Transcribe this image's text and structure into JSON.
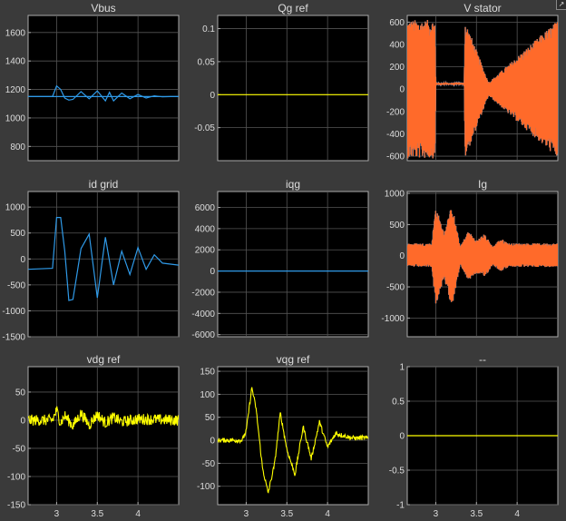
{
  "colors": {
    "figure_bg": "#3a3a3a",
    "axes_bg": "#000000",
    "axes_edge": "#aaaaaa",
    "grid": "#555555",
    "text": "#dddddd",
    "blue": "#2f9ae8",
    "orange": "#ff6a2a",
    "yellow": "#ffff00"
  },
  "icons": {
    "undock": "undock-arrow-icon"
  },
  "chart_data": [
    {
      "id": "vbus",
      "type": "line",
      "title": "Vbus",
      "xlim": [
        2.65,
        4.5
      ],
      "ylim": [
        700,
        1720
      ],
      "yticks": [
        "800",
        "1000",
        "1200",
        "1400",
        "1600"
      ],
      "xticks": [],
      "grid": true,
      "series": [
        {
          "color": "blue",
          "style": "line",
          "x": [
            2.65,
            2.95,
            3.0,
            3.05,
            3.1,
            3.15,
            3.2,
            3.3,
            3.4,
            3.5,
            3.6,
            3.65,
            3.7,
            3.8,
            3.9,
            4.0,
            4.1,
            4.2,
            4.3,
            4.4,
            4.5
          ],
          "y": [
            1150,
            1150,
            1225,
            1200,
            1140,
            1125,
            1130,
            1185,
            1135,
            1190,
            1120,
            1180,
            1120,
            1175,
            1135,
            1165,
            1140,
            1155,
            1148,
            1150,
            1150
          ]
        },
        {
          "color": "blue",
          "style": "flat",
          "x": [
            2.65,
            4.5
          ],
          "y": [
            1150,
            1150
          ]
        }
      ]
    },
    {
      "id": "qg_ref",
      "type": "line",
      "title": "Qg ref",
      "xlim": [
        2.65,
        4.5
      ],
      "ylim": [
        -0.1,
        0.12
      ],
      "yticks": [
        "-0.05",
        "0",
        "0.05",
        "0.1"
      ],
      "xticks": [],
      "grid": true,
      "series": [
        {
          "color": "yellow",
          "style": "flat",
          "x": [
            2.65,
            4.5
          ],
          "y": [
            0,
            0
          ]
        }
      ]
    },
    {
      "id": "v_stator",
      "type": "line",
      "title": "V stator",
      "xlim": [
        2.65,
        4.5
      ],
      "ylim": [
        -640,
        660
      ],
      "yticks": [
        "-600",
        "-400",
        "-200",
        "0",
        "200",
        "400",
        "600"
      ],
      "xticks": [],
      "grid": true,
      "series": [
        {
          "color": "orange",
          "style": "envelope",
          "x": [
            2.65,
            2.99,
            3.0,
            3.35,
            3.36,
            3.65,
            4.5
          ],
          "upper": [
            620,
            620,
            55,
            55,
            620,
            60,
            620
          ],
          "lower": [
            -620,
            -620,
            55,
            55,
            -620,
            -60,
            -620
          ]
        }
      ]
    },
    {
      "id": "id_grid",
      "type": "line",
      "title": "id grid",
      "xlim": [
        2.65,
        4.5
      ],
      "ylim": [
        -1500,
        1300
      ],
      "yticks": [
        "-1500",
        "-1000",
        "-500",
        "0",
        "500",
        "1000"
      ],
      "xticks": [],
      "grid": true,
      "series": [
        {
          "color": "blue",
          "style": "line",
          "x": [
            2.65,
            2.95,
            3.0,
            3.05,
            3.1,
            3.15,
            3.2,
            3.25,
            3.3,
            3.4,
            3.5,
            3.6,
            3.7,
            3.8,
            3.9,
            4.0,
            4.1,
            4.2,
            4.3,
            4.5
          ],
          "y": [
            -200,
            -180,
            800,
            800,
            150,
            -800,
            -780,
            -300,
            200,
            480,
            -750,
            420,
            -500,
            150,
            -300,
            220,
            -200,
            80,
            -80,
            -120
          ]
        }
      ]
    },
    {
      "id": "iqg",
      "type": "line",
      "title": "iqg",
      "xlim": [
        2.65,
        4.5
      ],
      "ylim": [
        -6200,
        7500
      ],
      "yticks": [
        "-6000",
        "-4000",
        "-2000",
        "0",
        "2000",
        "4000",
        "6000"
      ],
      "xticks": [],
      "grid": true,
      "series": [
        {
          "color": "blue",
          "style": "flat",
          "x": [
            2.65,
            4.5
          ],
          "y": [
            0,
            0
          ]
        }
      ]
    },
    {
      "id": "ig",
      "type": "line",
      "title": "Ig",
      "xlim": [
        2.65,
        4.5
      ],
      "ylim": [
        -1300,
        1030
      ],
      "yticks": [
        "-1000",
        "-500",
        "0",
        "500",
        "1000"
      ],
      "xticks": [],
      "grid": true,
      "series": [
        {
          "color": "orange",
          "style": "envelope",
          "x": [
            2.65,
            2.95,
            3.0,
            3.1,
            3.2,
            3.3,
            3.4,
            3.5,
            3.6,
            3.7,
            3.8,
            3.9,
            4.0,
            4.1,
            4.5
          ],
          "upper": [
            200,
            200,
            800,
            380,
            820,
            150,
            400,
            250,
            350,
            150,
            280,
            200,
            200,
            200,
            200
          ],
          "lower": [
            -180,
            -180,
            -800,
            -380,
            -820,
            -150,
            -400,
            -280,
            -350,
            -150,
            -250,
            -180,
            -180,
            -180,
            -180
          ]
        }
      ]
    },
    {
      "id": "vdg_ref",
      "type": "line",
      "title": "vdg ref",
      "xlim": [
        2.65,
        4.5
      ],
      "ylim": [
        -150,
        95
      ],
      "yticks": [
        "-150",
        "-100",
        "-50",
        "0",
        "50"
      ],
      "xticks": [
        "3",
        "3.5",
        "4"
      ],
      "xtick_values": [
        3,
        3.5,
        4
      ],
      "grid": true,
      "series": [
        {
          "color": "yellow",
          "style": "noisy",
          "amp": 10,
          "x": [
            2.65,
            2.95,
            3.0,
            3.05,
            3.1,
            3.2,
            3.3,
            3.4,
            3.5,
            3.6,
            3.7,
            3.8,
            4.0,
            4.5
          ],
          "y": [
            0,
            0,
            18,
            -5,
            8,
            -10,
            12,
            -8,
            10,
            -5,
            5,
            -3,
            2,
            0
          ]
        }
      ]
    },
    {
      "id": "vqg_ref",
      "type": "line",
      "title": "vqg ref",
      "xlim": [
        2.65,
        4.5
      ],
      "ylim": [
        -140,
        160
      ],
      "yticks": [
        "-100",
        "-50",
        "0",
        "50",
        "100",
        "150"
      ],
      "xticks": [
        "3",
        "3.5",
        "4"
      ],
      "xtick_values": [
        3,
        3.5,
        4
      ],
      "grid": true,
      "series": [
        {
          "color": "yellow",
          "style": "noisy",
          "amp": 5,
          "x": [
            2.65,
            2.95,
            3.0,
            3.07,
            3.12,
            3.2,
            3.27,
            3.35,
            3.42,
            3.5,
            3.6,
            3.7,
            3.8,
            3.9,
            4.0,
            4.1,
            4.2,
            4.3,
            4.5
          ],
          "y": [
            0,
            0,
            20,
            115,
            70,
            -60,
            -115,
            -50,
            60,
            -20,
            -75,
            30,
            -40,
            40,
            -15,
            15,
            10,
            5,
            5
          ]
        }
      ]
    },
    {
      "id": "blank",
      "type": "line",
      "title": "--",
      "xlim": [
        2.65,
        4.5
      ],
      "ylim": [
        -1,
        1
      ],
      "yticks": [
        "-1",
        "-0.5",
        "0",
        "0.5",
        "1"
      ],
      "xticks": [
        "3",
        "3.5",
        "4"
      ],
      "xtick_values": [
        3,
        3.5,
        4
      ],
      "grid": true,
      "series": [
        {
          "color": "yellow",
          "style": "flat",
          "x": [
            2.65,
            4.5
          ],
          "y": [
            0,
            0
          ]
        }
      ]
    }
  ]
}
